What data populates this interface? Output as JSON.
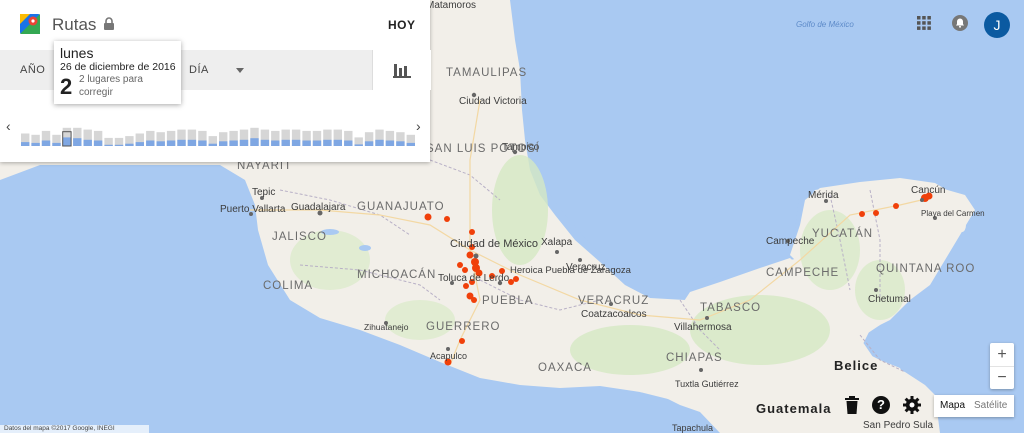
{
  "header": {
    "title": "Rutas",
    "today_label": "HOY"
  },
  "tabs": {
    "year": "AÑO",
    "day": "DÍA"
  },
  "tooltip": {
    "weekday": "lunes",
    "date": "26 de diciembre de 2016",
    "count": "2",
    "note": "2 lugares para corregir"
  },
  "timeline": {
    "values": [
      0.25,
      0.2,
      0.35,
      0.2,
      0.55,
      0.5,
      0.4,
      0.35,
      0.08,
      0.08,
      0.15,
      0.25,
      0.35,
      0.3,
      0.35,
      0.4,
      0.4,
      0.35,
      0.15,
      0.3,
      0.35,
      0.4,
      0.5,
      0.4,
      0.35,
      0.4,
      0.4,
      0.35,
      0.35,
      0.4,
      0.4,
      0.35,
      0.1,
      0.3,
      0.4,
      0.35,
      0.3,
      0.2
    ],
    "selected_index": 4
  },
  "account": {
    "initial": "J"
  },
  "zoom": {
    "in": "+",
    "out": "−"
  },
  "help": {
    "label": "?"
  },
  "maptype": {
    "map": "Mapa",
    "satellite": "Satélite"
  },
  "attribution": "Datos del mapa ©2017 Google, INEGI",
  "colors": {
    "water": "#a9c9f2",
    "land": "#f2efe9",
    "park": "#d5e9c3",
    "point": "#f0400a",
    "bar": "#7fa7e3",
    "bar_light": "#d6d6d6",
    "avatar": "#0b5aa1"
  },
  "map_labels": {
    "cities": [
      "Matamoros",
      "Ciudad Victoria",
      "Tampico",
      "Tepic",
      "Puerto Vallarta",
      "Guadalajara",
      "Ciudad de México",
      "Toluca de Lerdo",
      "Heroica Puebla de Zaragoza",
      "Xalapa",
      "Veracruz",
      "Coatzacoalcos",
      "Villahermosa",
      "Acapulco",
      "Zihuatanejo",
      "Mérida",
      "Cancún",
      "Playa del Carmen",
      "Campeche",
      "Chetumal",
      "Tuxtla Gutiérrez",
      "San Pedro Sula",
      "Tapachula"
    ],
    "states": [
      "TAMAULIPAS",
      "SAN LUIS POTOSÍ",
      "NAYARIT",
      "GUANAJUATO",
      "JALISCO",
      "MICHOACÁN",
      "COLIMA",
      "GUERRERO",
      "PUEBLA",
      "VERACRUZ",
      "OAXACA",
      "TABASCO",
      "CHIAPAS",
      "YUCATÁN",
      "CAMPECHE",
      "QUINTANA ROO"
    ],
    "countries": [
      "Belice",
      "Guatemala"
    ],
    "sea": "Golfo de México"
  }
}
